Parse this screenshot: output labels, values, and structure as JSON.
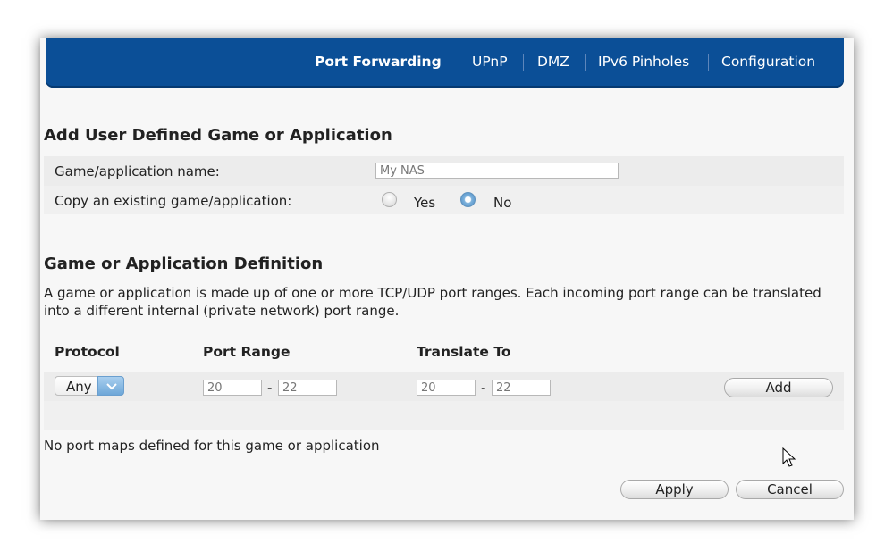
{
  "nav": {
    "items": [
      {
        "label": "Port Forwarding",
        "active": true
      },
      {
        "label": "UPnP",
        "active": false
      },
      {
        "label": "DMZ",
        "active": false
      },
      {
        "label": "IPv6 Pinholes",
        "active": false
      },
      {
        "label": "Configuration",
        "active": false
      }
    ]
  },
  "add_section": {
    "title": "Add User Defined Game or Application",
    "name_label": "Game/application name:",
    "name_value": "My NAS",
    "copy_label": "Copy an existing game/application:",
    "copy_options": [
      {
        "label": "Yes",
        "checked": false
      },
      {
        "label": "No",
        "checked": true
      }
    ]
  },
  "definition": {
    "title": "Game or Application Definition",
    "description": "A game or application is made up of one or more TCP/UDP port ranges. Each incoming port range can be translated into a different internal (private network) port range.",
    "columns": {
      "protocol": "Protocol",
      "port_range": "Port Range",
      "translate_to": "Translate To"
    },
    "protocol_value": "Any",
    "port_range": {
      "start": "20",
      "separator": "-",
      "end": "22"
    },
    "translate_to": {
      "start": "20",
      "separator": "-",
      "end": "22"
    },
    "add_label": "Add"
  },
  "status_text": "No port maps defined for this game or application",
  "actions": {
    "apply_label": "Apply",
    "cancel_label": "Cancel"
  },
  "icons": {
    "select_arrow": "chevron-down-icon",
    "cursor": "mouse-pointer-icon"
  },
  "colors": {
    "nav_bg": "#0b4f97",
    "accent": "#6ea7d8"
  }
}
